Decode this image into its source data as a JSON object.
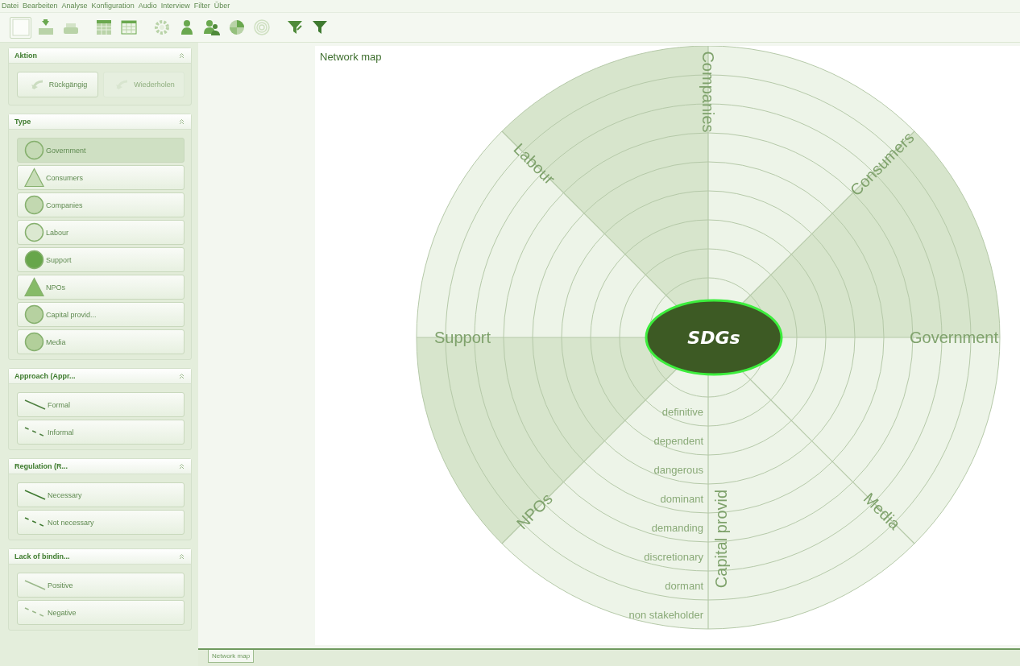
{
  "menu": [
    "Datei",
    "Bearbeiten",
    "Analyse",
    "Konfiguration",
    "Audio",
    "Interview",
    "Filter",
    "Über"
  ],
  "sidebar": {
    "groups": [
      {
        "title": "Aktion",
        "kind": "actions",
        "items": [
          {
            "label": "Rückgängig",
            "disabled": false
          },
          {
            "label": "Wiederholen",
            "disabled": true
          }
        ]
      },
      {
        "title": "Type",
        "kind": "shapes",
        "items": [
          {
            "label": "Government",
            "kind": "circle",
            "color": "#c5dab5",
            "selected": true
          },
          {
            "label": "Consumers",
            "kind": "triangle",
            "color": "#c8ddb8",
            "selected": false
          },
          {
            "label": "Companies",
            "kind": "circle",
            "color": "#c2d8b0",
            "selected": false
          },
          {
            "label": "Labour",
            "kind": "circle",
            "color": "#dbe8d0",
            "selected": false
          },
          {
            "label": "Support",
            "kind": "circle",
            "color": "#67a64a",
            "selected": false
          },
          {
            "label": "NPOs",
            "kind": "triangle",
            "color": "#86bb68",
            "selected": false
          },
          {
            "label": "Capital provid...",
            "kind": "circle",
            "color": "#b6d1a0",
            "selected": false
          },
          {
            "label": "Media",
            "kind": "circle",
            "color": "#b2cf9a",
            "selected": false
          }
        ]
      },
      {
        "title": "Approach (Appr...",
        "kind": "lines",
        "items": [
          {
            "label": "Formal",
            "kind": "solid",
            "color": "#4e8040"
          },
          {
            "label": "Informal",
            "kind": "dashed",
            "color": "#4e8040"
          }
        ]
      },
      {
        "title": "Regulation  (R...",
        "kind": "lines",
        "items": [
          {
            "label": "Necessary",
            "kind": "solid",
            "color": "#3f7a30"
          },
          {
            "label": "Not necessary",
            "kind": "dashed",
            "color": "#3f7a30"
          }
        ]
      },
      {
        "title": "Lack of bindin...",
        "kind": "lines",
        "items": [
          {
            "label": "Positive",
            "kind": "solid",
            "color": "#9ab88a"
          },
          {
            "label": "Negative",
            "kind": "dashed",
            "color": "#9ab88a"
          }
        ]
      }
    ]
  },
  "map": {
    "title": "Network map",
    "center": "SDGs",
    "sectors": [
      {
        "label": "Support",
        "shaded": false
      },
      {
        "label": "Labour",
        "shaded": true
      },
      {
        "label": "Companies",
        "shaded": false
      },
      {
        "label": "Consumers",
        "shaded": true
      },
      {
        "label": "Government",
        "shaded": false
      },
      {
        "label": "Media",
        "shaded": false
      },
      {
        "label": "Capital provid",
        "shaded": false
      },
      {
        "label": "NPOs",
        "shaded": true
      }
    ],
    "rings": [
      "definitive",
      "dependent",
      "dangerous",
      "dominant",
      "demanding",
      "discretionary",
      "dormant",
      "non stakeholder"
    ]
  },
  "tabs": [
    {
      "label": "Network map",
      "selected": true
    }
  ]
}
